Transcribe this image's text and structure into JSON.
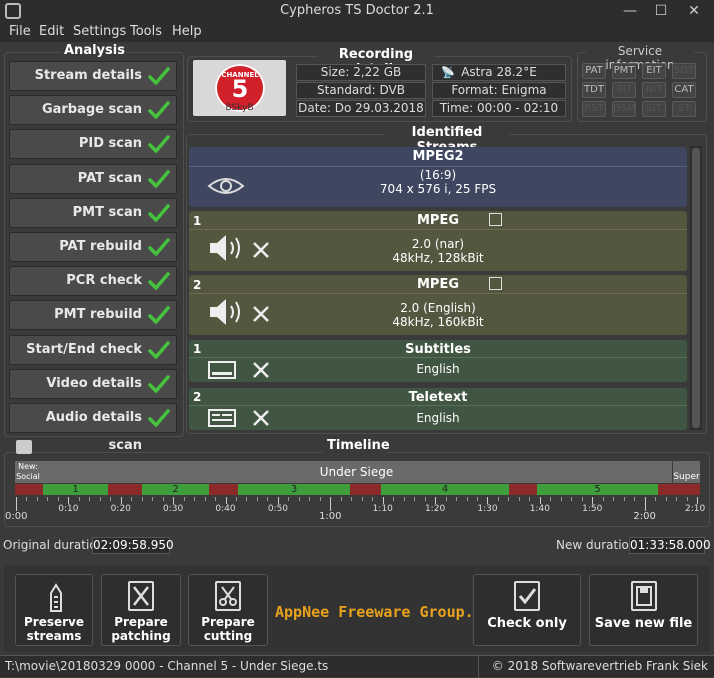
{
  "window": {
    "title": "Cypheros TS Doctor 2.1",
    "minimize": "—",
    "maximize": "☐",
    "close": "✕"
  },
  "menu": [
    "File",
    "Edit",
    "Settings",
    "Tools",
    "Help"
  ],
  "analysis": {
    "title": "Analysis",
    "items": [
      "Stream details",
      "Garbage scan",
      "PID scan",
      "PAT scan",
      "PMT scan",
      "PAT rebuild",
      "PCR check",
      "PMT rebuild",
      "Start/End check",
      "Video details scan",
      "Audio details scan"
    ]
  },
  "recording": {
    "title": "Recording details",
    "logo_text": "CHANNEL",
    "logo_num": "5",
    "logo_sub": "BSkyB",
    "size": "Size: 2,22 GB",
    "satellite": "Astra 28.2°E",
    "standard": "Standard: DVB",
    "format": "Format: Enigma",
    "date": "Date: Do 29.03.2018",
    "time": "Time: 00:00 - 02:10"
  },
  "service_info": {
    "title": "Service information",
    "buttons": [
      {
        "label": "PAT",
        "active": true
      },
      {
        "label": "PMT",
        "active": true
      },
      {
        "label": "EIT",
        "active": true
      },
      {
        "label": "SDT",
        "active": false
      },
      {
        "label": "TDT",
        "active": true
      },
      {
        "label": "BIT",
        "active": false
      },
      {
        "label": "NIT",
        "active": false
      },
      {
        "label": "CAT",
        "active": true
      },
      {
        "label": "RST",
        "active": false
      },
      {
        "label": "DSM",
        "active": false
      },
      {
        "label": "SIT",
        "active": false
      },
      {
        "label": "ST",
        "active": false
      }
    ]
  },
  "streams": {
    "title": "Identified Streams",
    "video": {
      "codec": "MPEG2",
      "aspect": "(16:9)",
      "details": "704 x 576 i, 25 FPS"
    },
    "audio1": {
      "num": "1",
      "codec": "MPEG",
      "line1": "2.0 (nar)",
      "line2": "48kHz, 128kBit"
    },
    "audio2": {
      "num": "2",
      "codec": "MPEG",
      "line1": "2.0 (English)",
      "line2": "48kHz, 160kBit"
    },
    "subs": {
      "num": "1",
      "type": "Subtitles",
      "lang": "English"
    },
    "teletext": {
      "num": "2",
      "type": "Teletext",
      "lang": "English"
    }
  },
  "timeline": {
    "title": "Timeline",
    "prev_label": "New:\nSocial",
    "program": "Under Siege",
    "next_label": "Super",
    "segments": [
      "1",
      "2",
      "3",
      "4",
      "5"
    ],
    "ticks": [
      "0:00",
      "0:10",
      "0:20",
      "0:30",
      "0:40",
      "0:50",
      "1:00",
      "1:10",
      "1:20",
      "1:30",
      "1:40",
      "1:50",
      "2:00",
      "2:10"
    ],
    "original_label": "Original duration:",
    "original_value": "02:09:58.950",
    "new_label": "New duration:",
    "new_value": "01:33:58.000"
  },
  "actions": {
    "preserve": "Preserve streams",
    "patching": "Prepare patching",
    "cutting": "Prepare cutting",
    "watermark": "AppNee Freeware Group.",
    "check": "Check only",
    "save": "Save new file"
  },
  "status": {
    "file": "T:\\movie\\20180329 0000 - Channel 5 - Under Siege.ts",
    "copyright": "© 2018 Softwarevertrieb Frank Siek"
  },
  "colors": {
    "video_bg": "#3e4660",
    "audio_bg": "#55563f",
    "sub_bg": "#405542",
    "check": "#45c33c",
    "seg_green": "#3f9e3c",
    "seg_red": "#8c2a2a",
    "watermark": "#e8a21c"
  }
}
